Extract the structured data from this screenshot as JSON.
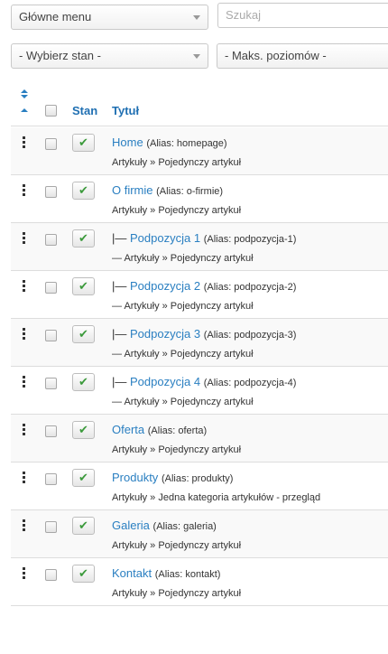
{
  "filters": {
    "menu_select": "Główne menu",
    "search_placeholder": "Szukaj",
    "state_select": "- Wybierz stan -",
    "levels_select": "- Maks. poziomów -"
  },
  "table": {
    "header": {
      "state": "Stan",
      "title": "Tytuł"
    },
    "rows": [
      {
        "prefix": "",
        "title": "Home",
        "alias": "(Alias: homepage)",
        "type_prefix": "",
        "type": "Artykuły » Pojedynczy artykuł"
      },
      {
        "prefix": "",
        "title": "O firmie",
        "alias": "(Alias: o-firmie)",
        "type_prefix": "",
        "type": "Artykuły » Pojedynczy artykuł"
      },
      {
        "prefix": "|— ",
        "title": "Podpozycja 1",
        "alias": "(Alias: podpozycja-1)",
        "type_prefix": "— ",
        "type": "Artykuły » Pojedynczy artykuł"
      },
      {
        "prefix": "|— ",
        "title": "Podpozycja 2",
        "alias": "(Alias: podpozycja-2)",
        "type_prefix": "— ",
        "type": "Artykuły » Pojedynczy artykuł"
      },
      {
        "prefix": "|— ",
        "title": "Podpozycja 3",
        "alias": "(Alias: podpozycja-3)",
        "type_prefix": "— ",
        "type": "Artykuły » Pojedynczy artykuł"
      },
      {
        "prefix": "|— ",
        "title": "Podpozycja 4",
        "alias": "(Alias: podpozycja-4)",
        "type_prefix": "— ",
        "type": "Artykuły » Pojedynczy artykuł"
      },
      {
        "prefix": "",
        "title": "Oferta",
        "alias": "(Alias: oferta)",
        "type_prefix": "",
        "type": "Artykuły » Pojedynczy artykuł"
      },
      {
        "prefix": "",
        "title": "Produkty",
        "alias": "(Alias: produkty)",
        "type_prefix": "",
        "type": "Artykuły » Jedna kategoria artykułów - przegląd"
      },
      {
        "prefix": "",
        "title": "Galeria",
        "alias": "(Alias: galeria)",
        "type_prefix": "",
        "type": "Artykuły » Pojedynczy artykuł"
      },
      {
        "prefix": "",
        "title": "Kontakt",
        "alias": "(Alias: kontakt)",
        "type_prefix": "",
        "type": "Artykuły » Pojedynczy artykuł"
      }
    ]
  },
  "icons": {
    "state_published": "check-icon",
    "drag": "drag-handle-icon",
    "sort": "sort-arrows-icon"
  },
  "colors": {
    "link": "#2a7fc1",
    "check": "#3c9a3c"
  }
}
